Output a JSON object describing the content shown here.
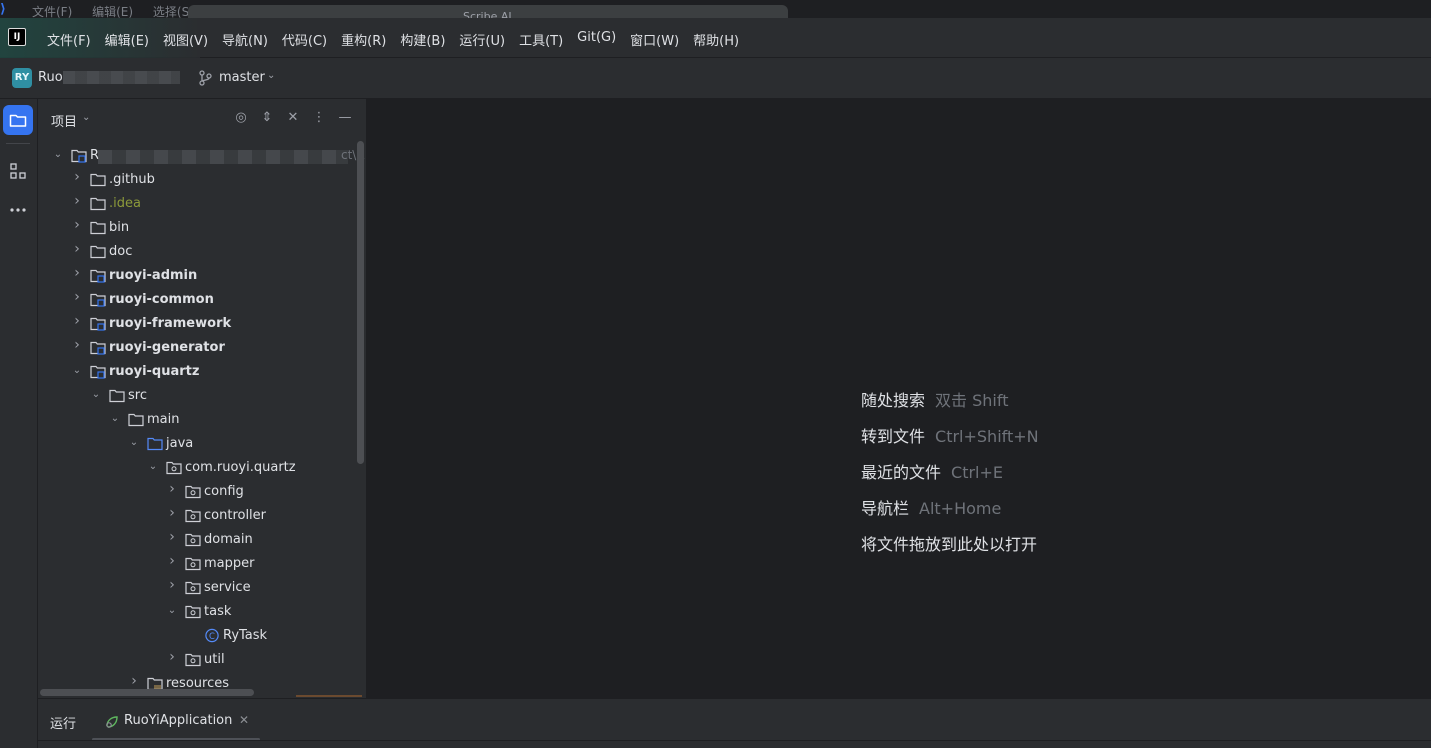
{
  "window": {
    "ghost_menu": [
      "文件(F)",
      "编辑(E)",
      "选择(S)"
    ],
    "ghost_tab_title": "Scribe AI"
  },
  "menubar": {
    "logo_text": "IJ",
    "items": [
      "文件(F)",
      "编辑(E)",
      "视图(V)",
      "导航(N)",
      "代码(C)",
      "重构(R)",
      "构建(B)",
      "运行(U)",
      "工具(T)",
      "Git(G)",
      "窗口(W)",
      "帮助(H)"
    ]
  },
  "toolbar": {
    "project_badge": "RY",
    "project_name": "Ruo",
    "branch_icon": "git-branch-icon",
    "branch": "master"
  },
  "left_strip": {
    "icons": [
      "folder-icon",
      "structure-icon",
      "more-icon"
    ]
  },
  "project_panel": {
    "title": "项目",
    "header_icons": [
      "locate-icon",
      "expand-all-icon",
      "collapse-all-icon",
      "options-icon",
      "minimize-icon"
    ],
    "root": {
      "prefix": "R",
      "tail": "ct\\R"
    },
    "tree": [
      {
        "label": ".github",
        "level": 1,
        "state": "collapsed",
        "icon": "folder",
        "style": "normal"
      },
      {
        "label": ".idea",
        "level": 1,
        "state": "collapsed",
        "icon": "folder",
        "style": "idea"
      },
      {
        "label": "bin",
        "level": 1,
        "state": "collapsed",
        "icon": "folder",
        "style": "normal"
      },
      {
        "label": "doc",
        "level": 1,
        "state": "collapsed",
        "icon": "folder",
        "style": "normal"
      },
      {
        "label": "ruoyi-admin",
        "level": 1,
        "state": "collapsed",
        "icon": "module",
        "style": "bold"
      },
      {
        "label": "ruoyi-common",
        "level": 1,
        "state": "collapsed",
        "icon": "module",
        "style": "bold"
      },
      {
        "label": "ruoyi-framework",
        "level": 1,
        "state": "collapsed",
        "icon": "module",
        "style": "bold"
      },
      {
        "label": "ruoyi-generator",
        "level": 1,
        "state": "collapsed",
        "icon": "module",
        "style": "bold"
      },
      {
        "label": "ruoyi-quartz",
        "level": 1,
        "state": "expanded",
        "icon": "module",
        "style": "bold"
      },
      {
        "label": "src",
        "level": 2,
        "state": "expanded",
        "icon": "folder",
        "style": "normal"
      },
      {
        "label": "main",
        "level": 3,
        "state": "expanded",
        "icon": "folder",
        "style": "normal"
      },
      {
        "label": "java",
        "level": 4,
        "state": "expanded",
        "icon": "source-folder",
        "style": "normal"
      },
      {
        "label": "com.ruoyi.quartz",
        "level": 5,
        "state": "expanded",
        "icon": "package",
        "style": "normal"
      },
      {
        "label": "config",
        "level": 6,
        "state": "collapsed",
        "icon": "package",
        "style": "normal"
      },
      {
        "label": "controller",
        "level": 6,
        "state": "collapsed",
        "icon": "package",
        "style": "normal"
      },
      {
        "label": "domain",
        "level": 6,
        "state": "collapsed",
        "icon": "package",
        "style": "normal"
      },
      {
        "label": "mapper",
        "level": 6,
        "state": "collapsed",
        "icon": "package",
        "style": "normal"
      },
      {
        "label": "service",
        "level": 6,
        "state": "collapsed",
        "icon": "package",
        "style": "normal"
      },
      {
        "label": "task",
        "level": 6,
        "state": "expanded",
        "icon": "package",
        "style": "normal"
      },
      {
        "label": "RyTask",
        "level": 7,
        "state": "none",
        "icon": "class",
        "style": "normal"
      },
      {
        "label": "util",
        "level": 6,
        "state": "collapsed",
        "icon": "package",
        "style": "normal"
      },
      {
        "label": "resources",
        "level": 4,
        "state": "collapsed",
        "icon": "resources-folder",
        "style": "normal"
      }
    ]
  },
  "editor": {
    "hints": [
      {
        "action": "随处搜索",
        "shortcut": "双击 Shift"
      },
      {
        "action": "转到文件",
        "shortcut": "Ctrl+Shift+N"
      },
      {
        "action": "最近的文件",
        "shortcut": "Ctrl+E"
      },
      {
        "action": "导航栏",
        "shortcut": "Alt+Home"
      },
      {
        "action": "将文件拖放到此处以打开",
        "shortcut": ""
      }
    ]
  },
  "bottom": {
    "run_label": "运行",
    "run_tab": "RuoYiApplication",
    "close_icon": "close-icon"
  },
  "colors": {
    "accent": "#3574f0",
    "panel_bg": "#2b2d30",
    "editor_bg": "#1e1f22",
    "text": "#dfe1e5",
    "muted": "#6f737a",
    "idea_folder": "#8c9a3a"
  }
}
